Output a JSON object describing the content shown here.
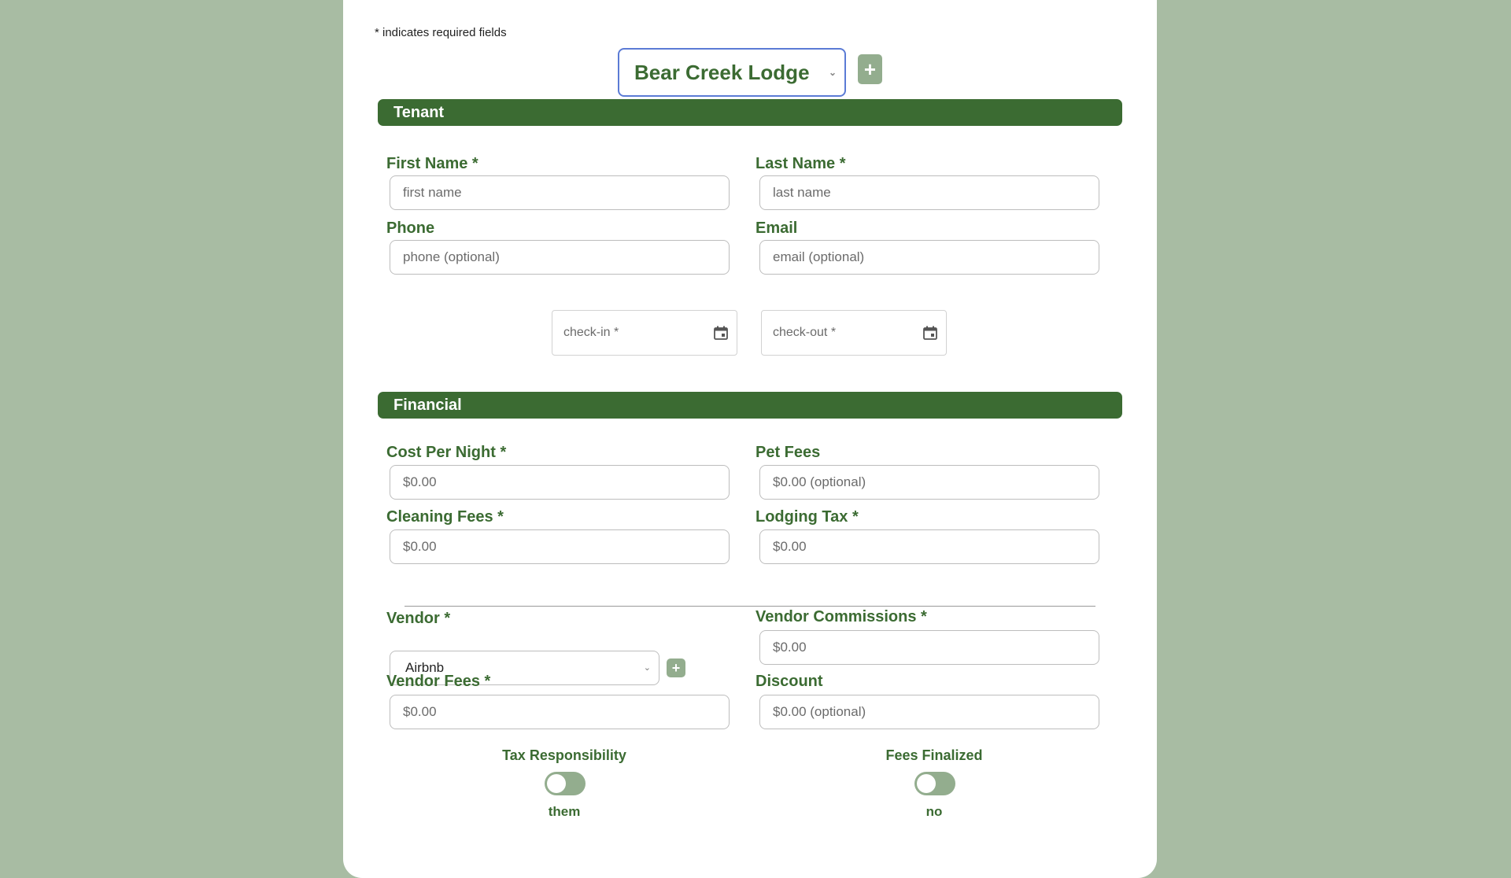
{
  "form": {
    "required_note": "* indicates required fields",
    "property": {
      "selected": "Bear Creek Lodge",
      "chevron_icon": "chevron-down-icon",
      "add_label": "+"
    },
    "tenant": {
      "title": "Tenant",
      "first_name": {
        "label": "First Name *",
        "placeholder": "first name"
      },
      "last_name": {
        "label": "Last Name *",
        "placeholder": "last name"
      },
      "phone": {
        "label": "Phone",
        "placeholder": "phone (optional)"
      },
      "email": {
        "label": "Email",
        "placeholder": "email (optional)"
      },
      "check_in": {
        "placeholder": "check-in *",
        "icon": "calendar-icon"
      },
      "check_out": {
        "placeholder": "check-out *",
        "icon": "calendar-icon"
      }
    },
    "financial": {
      "title": "Financial",
      "cost_per_night": {
        "label": "Cost Per Night *",
        "placeholder": "$0.00"
      },
      "pet_fees": {
        "label": "Pet Fees",
        "placeholder": "$0.00 (optional)"
      },
      "cleaning_fees": {
        "label": "Cleaning Fees *",
        "placeholder": "$0.00"
      },
      "lodging_tax": {
        "label": "Lodging Tax *",
        "placeholder": "$0.00"
      },
      "vendor": {
        "label": "Vendor *",
        "selected": "Airbnb",
        "add_label": "+"
      },
      "vendor_commissions": {
        "label": "Vendor Commissions *",
        "placeholder": "$0.00"
      },
      "vendor_fees": {
        "label": "Vendor Fees *",
        "placeholder": "$0.00"
      },
      "discount": {
        "label": "Discount",
        "placeholder": "$0.00 (optional)"
      },
      "tax_responsibility": {
        "label": "Tax Responsibility",
        "value": "them",
        "on": false
      },
      "fees_finalized": {
        "label": "Fees Finalized",
        "value": "no",
        "on": false
      }
    }
  },
  "colors": {
    "background": "#a8bca3",
    "accent": "#3b6b32",
    "toggle_off": "#93ad8e",
    "focus": "#5b7bd5"
  }
}
